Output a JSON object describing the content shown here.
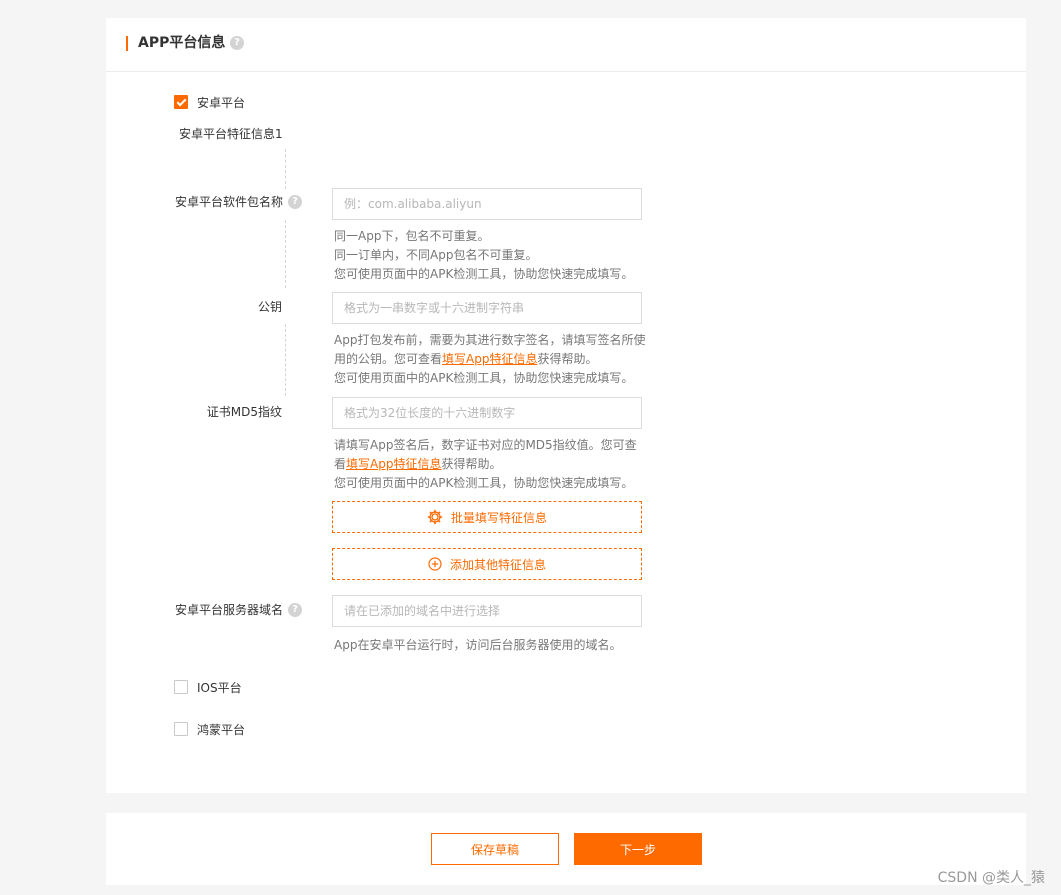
{
  "section": {
    "title": "APP平台信息",
    "help_glyph": "?"
  },
  "android": {
    "checkbox_label": "安卓平台",
    "checked": true,
    "feature_title": "安卓平台特征信息1",
    "package": {
      "label": "安卓平台软件包名称",
      "placeholder": "例：com.alibaba.aliyun",
      "value": "",
      "hint": [
        "同一App下，包名不可重复。",
        "同一订单内，不同App包名不可重复。",
        "您可使用页面中的APK检测工具，协助您快速完成填写。"
      ]
    },
    "public_key": {
      "label": "公钥",
      "placeholder": "格式为一串数字或十六进制字符串",
      "value": "",
      "hint_line1": "App打包发布前，需要为其进行数字签名，请填写签名所使",
      "hint_line2_pre": "用的公钥。您可查看",
      "hint_link": "填写App特征信息",
      "hint_line2_post": "获得帮助。",
      "hint_line3": "您可使用页面中的APK检测工具，协助您快速完成填写。"
    },
    "md5": {
      "label": "证书MD5指纹",
      "placeholder": "格式为32位长度的十六进制数字",
      "value": "",
      "hint_line1": "请填写App签名后，数字证书对应的MD5指纹值。您可查",
      "hint_line2_pre": "看",
      "hint_link": "填写App特征信息",
      "hint_line2_post": "获得帮助。",
      "hint_line3": "您可使用页面中的APK检测工具，协助您快速完成填写。"
    },
    "batch_button": "批量填写特征信息",
    "add_button": "添加其他特征信息",
    "domain": {
      "label": "安卓平台服务器域名",
      "placeholder": "请在已添加的域名中进行选择",
      "value": "",
      "hint": "App在安卓平台运行时，访问后台服务器使用的域名。"
    }
  },
  "ios": {
    "checkbox_label": "IOS平台",
    "checked": false
  },
  "harmony": {
    "checkbox_label": "鸿蒙平台",
    "checked": false
  },
  "footer": {
    "save_draft": "保存草稿",
    "next": "下一步"
  },
  "watermark": "CSDN @类人_猿",
  "colors": {
    "accent": "#ff6a00",
    "background": "#f5f5f5",
    "card": "#ffffff"
  }
}
